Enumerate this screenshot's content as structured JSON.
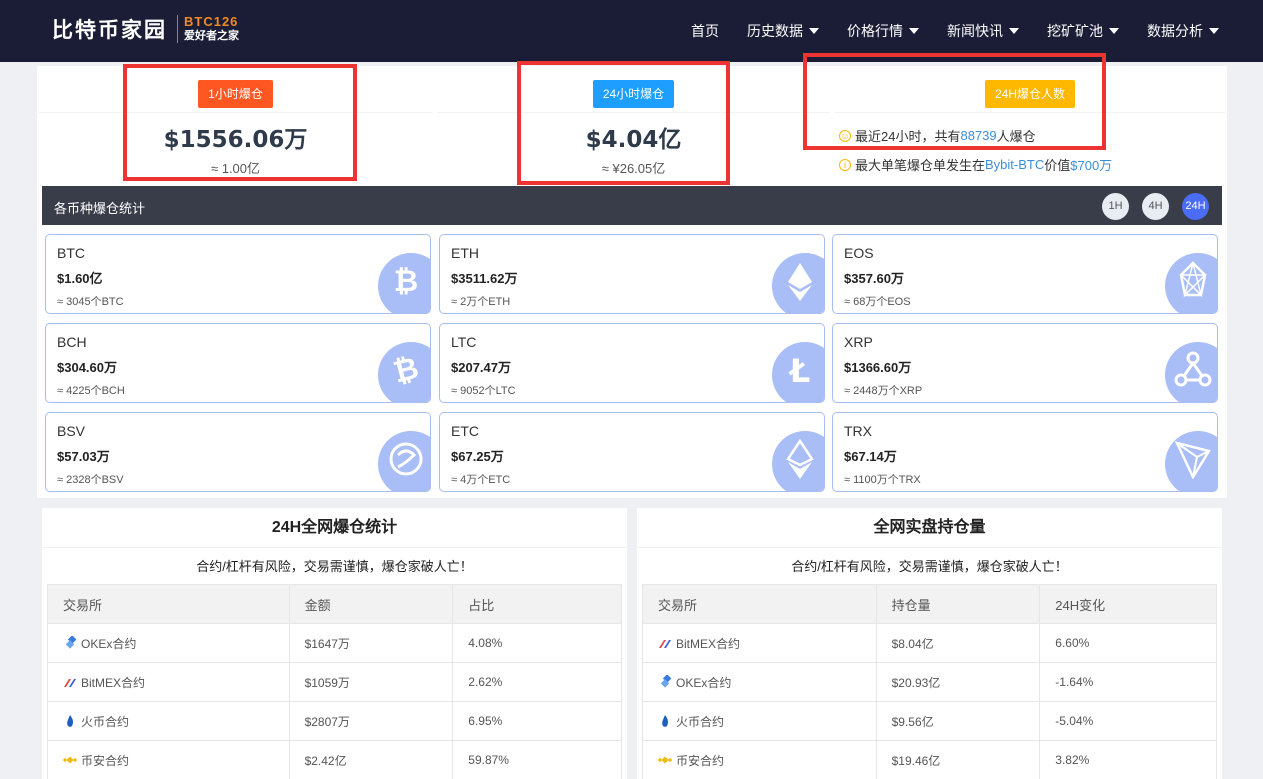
{
  "header": {
    "logo_main": "比特币家园",
    "logo_brand": "BTC126",
    "logo_slogan": "爱好者之家",
    "nav": [
      {
        "label": "首页",
        "dropdown": false
      },
      {
        "label": "历史数据",
        "dropdown": true
      },
      {
        "label": "价格行情",
        "dropdown": true
      },
      {
        "label": "新闻快讯",
        "dropdown": true
      },
      {
        "label": "挖矿矿池",
        "dropdown": true
      },
      {
        "label": "数据分析",
        "dropdown": true
      }
    ]
  },
  "summary": {
    "hour1": {
      "badge": "1小时爆仓",
      "value": "$1556.06万",
      "sub": "≈ 1.00亿"
    },
    "hour24": {
      "badge": "24小时爆仓",
      "value": "$4.04亿",
      "sub": "≈ ¥26.05亿"
    },
    "people": {
      "badge": "24H爆仓人数",
      "line1_prefix": "最近24小时，共有",
      "line1_count": "88739",
      "line1_suffix": "人爆仓",
      "line2_prefix": "最大单笔爆仓单发生在",
      "line2_exchange": "Bybit-BTC",
      "line2_mid": "价值",
      "line2_value": "$700万"
    }
  },
  "coin_stats": {
    "title": "各币种爆仓统计",
    "timeframes": [
      "1H",
      "4H",
      "24H"
    ],
    "active_timeframe": "24H",
    "coins": [
      {
        "name": "BTC",
        "usd": "$1.60亿",
        "amount": "≈ 3045个BTC",
        "icon": "bitcoin-icon"
      },
      {
        "name": "ETH",
        "usd": "$3511.62万",
        "amount": "≈ 2万个ETH",
        "icon": "ethereum-icon"
      },
      {
        "name": "EOS",
        "usd": "$357.60万",
        "amount": "≈ 68万个EOS",
        "icon": "eos-icon"
      },
      {
        "name": "BCH",
        "usd": "$304.60万",
        "amount": "≈ 4225个BCH",
        "icon": "bitcoin-cash-icon"
      },
      {
        "name": "LTC",
        "usd": "$207.47万",
        "amount": "≈ 9052个LTC",
        "icon": "litecoin-icon"
      },
      {
        "name": "XRP",
        "usd": "$1366.60万",
        "amount": "≈ 2448万个XRP",
        "icon": "ripple-icon"
      },
      {
        "name": "BSV",
        "usd": "$57.03万",
        "amount": "≈ 2328个BSV",
        "icon": "bsv-icon"
      },
      {
        "name": "ETC",
        "usd": "$67.25万",
        "amount": "≈ 4万个ETC",
        "icon": "ethereum-classic-icon"
      },
      {
        "name": "TRX",
        "usd": "$67.14万",
        "amount": "≈ 1100万个TRX",
        "icon": "tron-icon"
      }
    ]
  },
  "liquidation_table": {
    "title": "24H全网爆仓统计",
    "warning": "合约/杠杆有风险，交易需谨慎，爆仓家破人亡！",
    "headers": [
      "交易所",
      "金额",
      "占比"
    ],
    "rows": [
      {
        "exchange": "OKEx合约",
        "icon": "okex-icon",
        "amount": "$1647万",
        "ratio": "4.08%"
      },
      {
        "exchange": "BitMEX合约",
        "icon": "bitmex-icon",
        "amount": "$1059万",
        "ratio": "2.62%"
      },
      {
        "exchange": "火币合约",
        "icon": "huobi-icon",
        "amount": "$2807万",
        "ratio": "6.95%"
      },
      {
        "exchange": "币安合约",
        "icon": "binance-icon",
        "amount": "$2.42亿",
        "ratio": "59.87%"
      }
    ]
  },
  "position_table": {
    "title": "全网实盘持仓量",
    "warning": "合约/杠杆有风险，交易需谨慎，爆仓家破人亡！",
    "headers": [
      "交易所",
      "持仓量",
      "24H变化"
    ],
    "rows": [
      {
        "exchange": "BitMEX合约",
        "icon": "bitmex-icon",
        "amount": "$8.04亿",
        "ratio": "6.60%"
      },
      {
        "exchange": "OKEx合约",
        "icon": "okex-icon",
        "amount": "$20.93亿",
        "ratio": "-1.64%"
      },
      {
        "exchange": "火币合约",
        "icon": "huobi-icon",
        "amount": "$9.56亿",
        "ratio": "-5.04%"
      },
      {
        "exchange": "币安合约",
        "icon": "binance-icon",
        "amount": "$19.46亿",
        "ratio": "3.82%"
      }
    ]
  },
  "colors": {
    "header_bg": "#1b1d36",
    "badge_red": "#ff5722",
    "badge_blue": "#1e9fff",
    "badge_yellow": "#ffb800",
    "highlight": "#ee3333",
    "link_blue": "#3b8fd9",
    "timeframe_active": "#4a6cf7"
  }
}
